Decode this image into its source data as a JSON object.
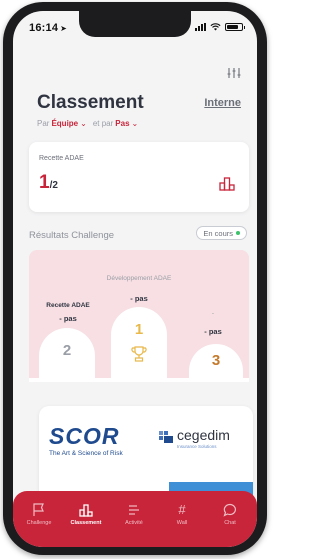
{
  "status_bar": {
    "time": "16:14",
    "location_icon": "location-arrow-icon"
  },
  "header": {
    "title": "Classement",
    "scope_link": "Interne",
    "filter_icon": "sliders-icon"
  },
  "sort": {
    "by_prefix": "Par",
    "by_value": "Équipe",
    "and_prefix": "et par",
    "and_value": "Pas"
  },
  "rank_card": {
    "label": "Recette ADAE",
    "rank": "1",
    "total": "/2",
    "icon": "podium-icon"
  },
  "challenge": {
    "section_title": "Résultats Challenge",
    "status": "En cours",
    "status_color": "#3cc26b",
    "podium": [
      {
        "position": "2",
        "team": "Recette ADAE",
        "score": "- pas",
        "color": "#9a9ea6"
      },
      {
        "position": "1",
        "team": "Développement ADAE",
        "score": "- pas",
        "color": "#e8b84a"
      },
      {
        "position": "3",
        "team": "-",
        "score": "- pas",
        "color": "#c47a2c"
      }
    ]
  },
  "sponsors": {
    "scor_name": "SCOR",
    "scor_tagline": "The Art & Science of Risk",
    "cegedim_name": "cegedim",
    "cegedim_tagline": "Insurance Solutions"
  },
  "tabs": [
    {
      "label": "Challenge",
      "icon": "flag-icon",
      "active": false
    },
    {
      "label": "Classement",
      "icon": "podium-icon",
      "active": true
    },
    {
      "label": "Activité",
      "icon": "activity-list-icon",
      "active": false
    },
    {
      "label": "Wall",
      "icon": "hashtag-icon",
      "active": false
    },
    {
      "label": "Chat",
      "icon": "chat-bubble-icon",
      "active": false
    }
  ],
  "colors": {
    "accent": "#c8243a",
    "podium_bg": "#f7dfe3"
  }
}
